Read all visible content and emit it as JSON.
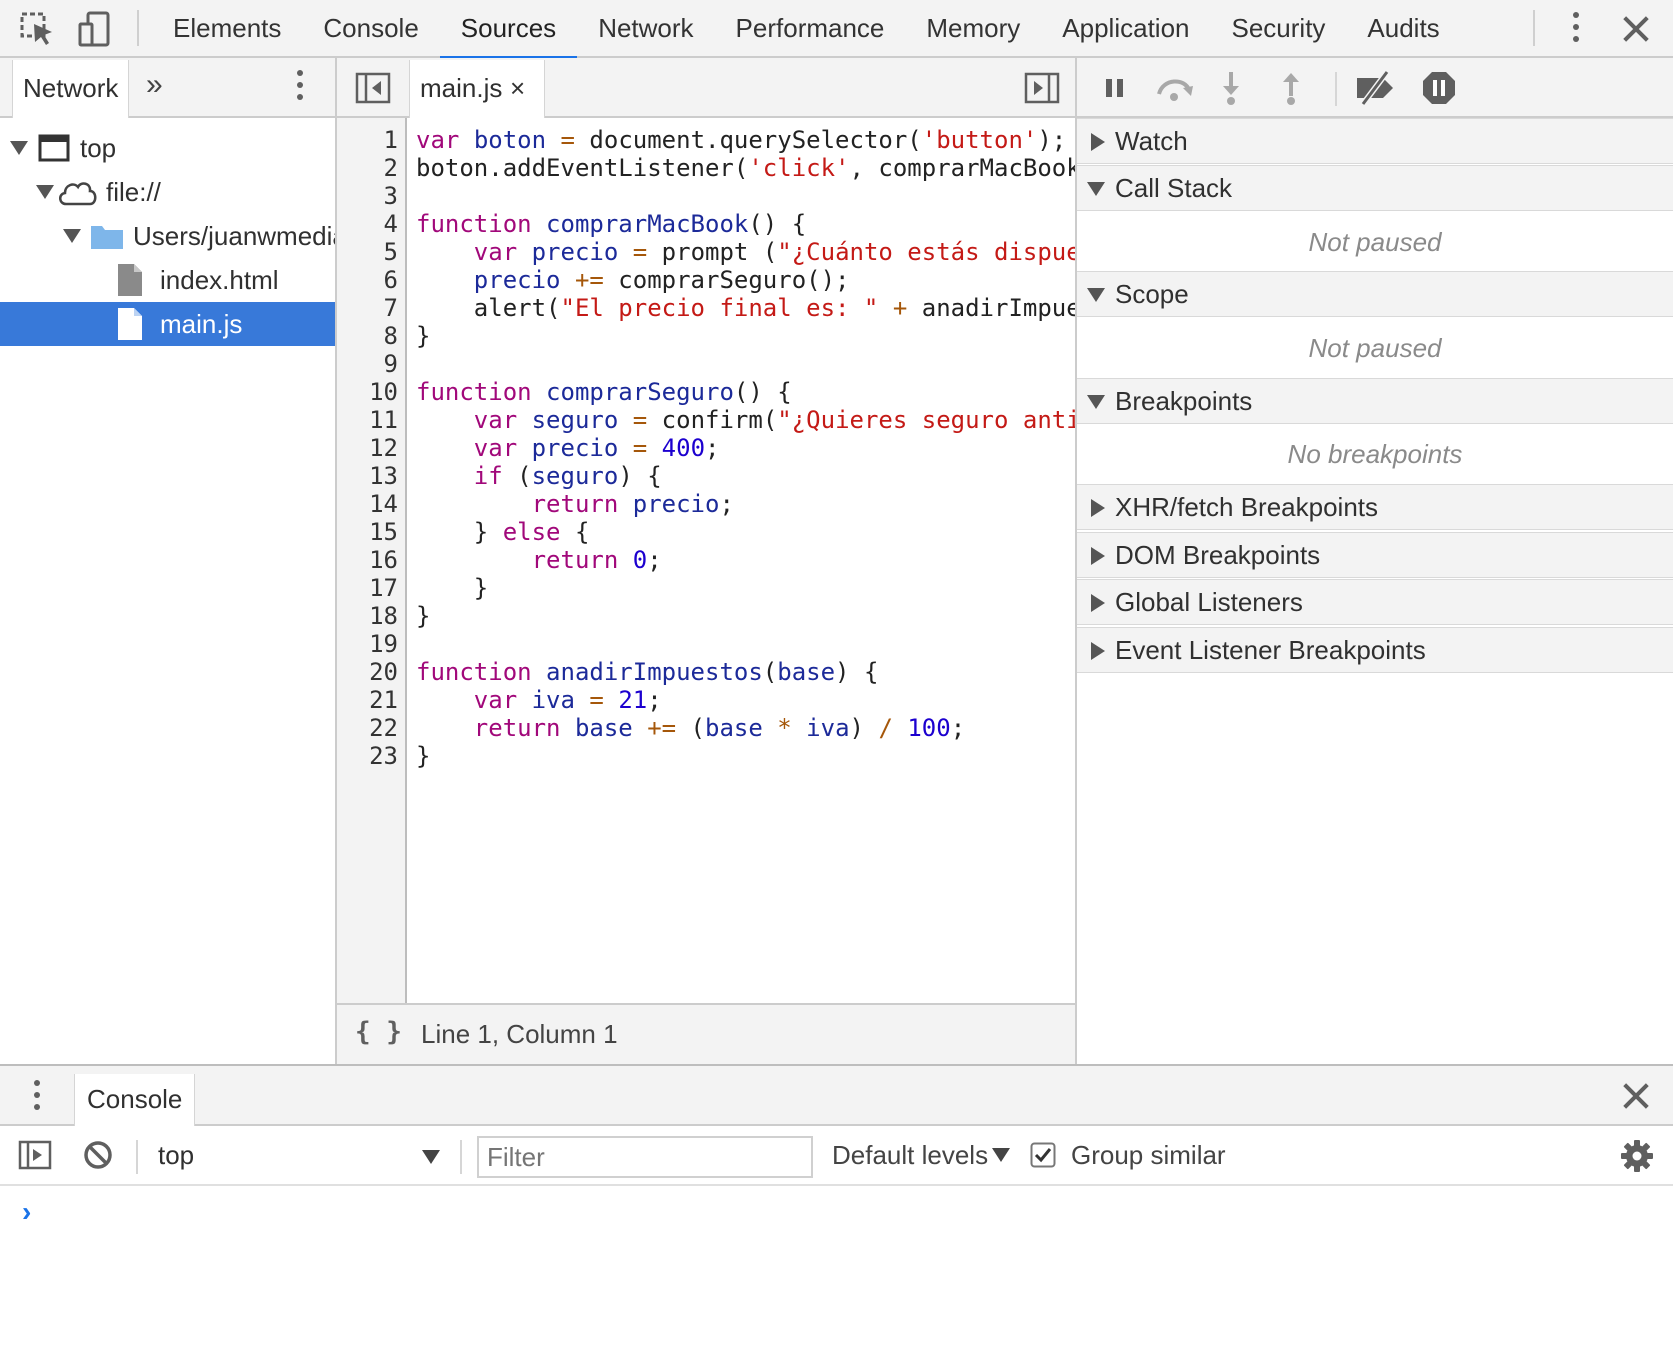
{
  "toolbar": {
    "tabs": [
      {
        "label": "Elements"
      },
      {
        "label": "Console"
      },
      {
        "label": "Sources"
      },
      {
        "label": "Network"
      },
      {
        "label": "Performance"
      },
      {
        "label": "Memory"
      },
      {
        "label": "Application"
      },
      {
        "label": "Security"
      },
      {
        "label": "Audits"
      }
    ],
    "active_tab": "Sources",
    "icons": [
      "inspect-element-icon",
      "device-toggle-icon",
      "kebab-menu-icon",
      "close-icon"
    ]
  },
  "navigator": {
    "tab_label": "Network",
    "more_label": "»",
    "tree": [
      {
        "label": "top",
        "level": 0,
        "icon": "frame-icon"
      },
      {
        "label": "file://",
        "level": 1,
        "icon": "cloud-icon"
      },
      {
        "label": "Users/juanwmedia",
        "level": 2,
        "icon": "folder-icon"
      },
      {
        "label": "index.html",
        "level": 3,
        "icon": "file-icon"
      },
      {
        "label": "main.js",
        "level": 3,
        "icon": "file-icon",
        "selected": true
      }
    ]
  },
  "editor": {
    "file_tab": "main.js",
    "close_glyph": "×",
    "status": "Line 1, Column 1",
    "format_glyph": "{ }",
    "lines": [
      "1",
      "2",
      "3",
      "4",
      "5",
      "6",
      "7",
      "8",
      "9",
      "10",
      "11",
      "12",
      "13",
      "14",
      "15",
      "16",
      "17",
      "18",
      "19",
      "20",
      "21",
      "22",
      "23"
    ]
  },
  "debugger": {
    "panes": [
      {
        "label": "Watch",
        "expanded": false
      },
      {
        "label": "Call Stack",
        "expanded": true,
        "body": "Not paused"
      },
      {
        "label": "Scope",
        "expanded": true,
        "body": "Not paused"
      },
      {
        "label": "Breakpoints",
        "expanded": true,
        "body": "No breakpoints"
      },
      {
        "label": "XHR/fetch Breakpoints",
        "expanded": false
      },
      {
        "label": "DOM Breakpoints",
        "expanded": false
      },
      {
        "label": "Global Listeners",
        "expanded": false
      },
      {
        "label": "Event Listener Breakpoints",
        "expanded": false
      }
    ]
  },
  "drawer": {
    "tab_label": "Console",
    "context": "top",
    "filter_placeholder": "Filter",
    "levels_label": "Default levels",
    "group_similar_label": "Group similar",
    "group_similar_checked": true,
    "prompt_glyph": "›"
  },
  "colors": {
    "accent": "#1a73e8",
    "selection": "#3879d9",
    "toolbar_bg": "#f3f3f3"
  }
}
